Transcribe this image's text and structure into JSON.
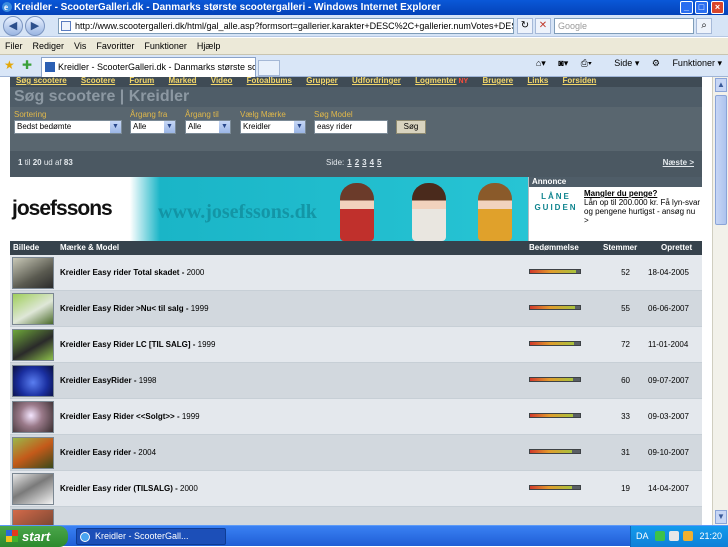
{
  "window": {
    "title": "Kreidler - ScooterGalleri.dk - Danmarks største scootergalleri - Windows Internet Explorer"
  },
  "address": {
    "url": "http://www.scootergalleri.dk/html/gal_alle.asp?formsort=gallerier.karakter+DESC%2C+gallerier.numVotes+DESC&formYearFro",
    "search_placeholder": "Google"
  },
  "menu": [
    "Filer",
    "Rediger",
    "Vis",
    "Favoritter",
    "Funktioner",
    "Hjælp"
  ],
  "tab": {
    "label": "Kreidler - ScooterGalleri.dk - Danmarks største scooterg..."
  },
  "commandbar": {
    "page": "Side",
    "tools": "Funktioner"
  },
  "site": {
    "nav": [
      "Søg scootere",
      "Scootere",
      "Forum",
      "Marked",
      "Video",
      "Fotoalbums",
      "Grupper",
      "Udfordringer",
      "Logmenter",
      "Brugere",
      "Links",
      "Forsiden"
    ],
    "nav_hot": "NY",
    "page_title": "Søg scootere | Kreidler",
    "filters": {
      "sort_label": "Sortering",
      "sort_value": "Bedst bedømte",
      "year_from_label": "Årgang fra",
      "year_from_value": "Alle",
      "year_to_label": "Årgang til",
      "year_to_value": "Alle",
      "brand_label": "Vælg Mærke",
      "brand_value": "Kreidler",
      "model_label": "Søg Model",
      "model_value": "easy rider",
      "search_button": "Søg"
    },
    "pager": {
      "range_from": "1",
      "range_to": "20",
      "range_total": "83",
      "prefix_to": "til",
      "prefix_of": "ud af",
      "side_label": "Side:",
      "pages": [
        "1",
        "2",
        "3",
        "4",
        "5"
      ],
      "next": "Næste >"
    },
    "banner": {
      "brand": "josefssons",
      "url": "www.josefssons.dk"
    },
    "annonce": {
      "header": "Annonce",
      "logo": "LÅNE GUIDEN",
      "headline": "Mangler du penge?",
      "text": "Lån op til 200.000 kr. Få lyn-svar og pengene hurtigst - ansøg nu >"
    },
    "table": {
      "headers": {
        "image": "Billede",
        "brand_model": "Mærke & Model",
        "rating": "Bedømmelse",
        "votes": "Stemmer",
        "created": "Oprettet"
      },
      "rows": [
        {
          "name": "Kreidler Easy rider Total skadet",
          "year": "2000",
          "votes": "52",
          "date": "18-04-2005",
          "rating": 0.92
        },
        {
          "name": "Kreidler Easy Rider >Nu< til salg",
          "year": "1999",
          "votes": "55",
          "date": "06-06-2007",
          "rating": 0.9
        },
        {
          "name": "Kreidler Easy Rider LC [TIL SALG]",
          "year": "1999",
          "votes": "72",
          "date": "11-01-2004",
          "rating": 0.88
        },
        {
          "name": "Kreidler EasyRider",
          "year": "1998",
          "votes": "60",
          "date": "09-07-2007",
          "rating": 0.86
        },
        {
          "name": "Kreidler Easy Rider <<Solgt>>",
          "year": "1999",
          "votes": "33",
          "date": "09-03-2007",
          "rating": 0.85
        },
        {
          "name": "Kreidler Easy rider",
          "year": "2004",
          "votes": "31",
          "date": "09-10-2007",
          "rating": 0.84
        },
        {
          "name": "Kreidler Easy rider (TILSALG)",
          "year": "2000",
          "votes": "19",
          "date": "14-04-2007",
          "rating": 0.83
        }
      ]
    }
  },
  "taskbar": {
    "start": "start",
    "item": "Kreidler - ScooterGall...",
    "lang": "DA",
    "clock": "21:20"
  },
  "colors": {
    "accent": "#e1b84a",
    "page_bg": "#4f5d68"
  }
}
